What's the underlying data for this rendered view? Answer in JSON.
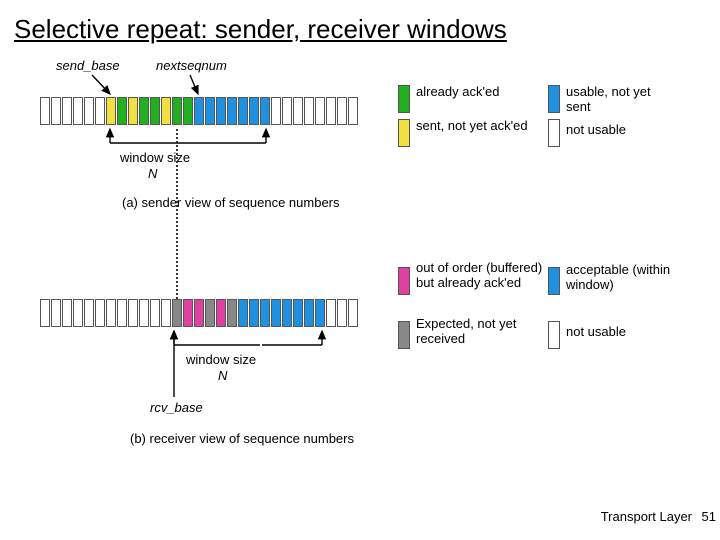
{
  "title": "Selective repeat: sender, receiver windows",
  "sender": {
    "label_send_base": "send_base",
    "label_nextseqnum": "nextseqnum",
    "window_size_label": "window size",
    "window_size_var": "N",
    "caption": "(a) sender view of sequence numbers",
    "legend": {
      "already_acked": "already ack'ed",
      "sent_not_acked": "sent, not yet ack'ed",
      "usable_not_sent": "usable, not yet sent",
      "not_usable": "not usable"
    }
  },
  "receiver": {
    "label_rcv_base": "rcv_base",
    "window_size_label": "window size",
    "window_size_var": "N",
    "caption": "(b) receiver view of sequence numbers",
    "legend": {
      "out_of_order": "out of order (buffered) but already ack'ed",
      "expected_not_received": "Expected, not yet received",
      "acceptable": "acceptable (within window)",
      "not_usable": "not usable"
    }
  },
  "footer": "Transport Layer",
  "page_number": "51"
}
